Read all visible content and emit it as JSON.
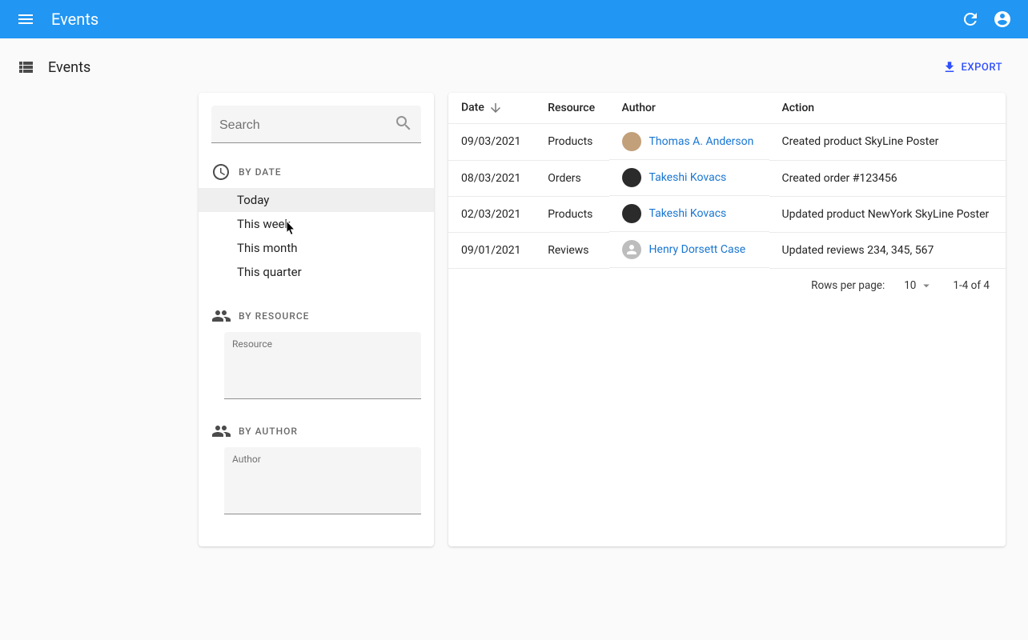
{
  "appbar": {
    "title": "Events"
  },
  "page": {
    "title": "Events",
    "export_label": "EXPORT"
  },
  "filters": {
    "search_placeholder": "Search",
    "by_date": {
      "header": "BY DATE",
      "items": [
        "Today",
        "This week",
        "This month",
        "This quarter"
      ],
      "hovered_index": 0
    },
    "by_resource": {
      "header": "BY RESOURCE",
      "field_label": "Resource"
    },
    "by_author": {
      "header": "BY AUTHOR",
      "field_label": "Author"
    }
  },
  "table": {
    "columns": {
      "date": "Date",
      "resource": "Resource",
      "author": "Author",
      "action": "Action"
    },
    "rows": [
      {
        "date": "09/03/2021",
        "resource": "Products",
        "author": "Thomas A. Anderson",
        "avatar_color": "#c2a07a",
        "action": "Created product SkyLine Poster"
      },
      {
        "date": "08/03/2021",
        "resource": "Orders",
        "author": "Takeshi Kovacs",
        "avatar_color": "#2b2b2b",
        "action": "Created order #123456"
      },
      {
        "date": "02/03/2021",
        "resource": "Products",
        "author": "Takeshi Kovacs",
        "avatar_color": "#2b2b2b",
        "action": "Updated product NewYork SkyLine Poster"
      },
      {
        "date": "09/01/2021",
        "resource": "Reviews",
        "author": "Henry Dorsett Case",
        "avatar_color": "placeholder",
        "action": "Updated reviews 234, 345, 567"
      }
    ]
  },
  "pagination": {
    "rows_label": "Rows per page:",
    "rows_value": "10",
    "range": "1-4 of 4"
  }
}
